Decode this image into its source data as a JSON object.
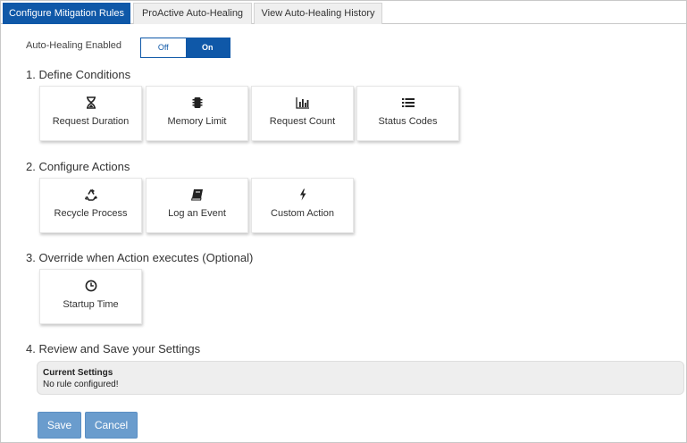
{
  "tabs": [
    {
      "label": "Configure Mitigation Rules",
      "active": true
    },
    {
      "label": "ProActive Auto-Healing",
      "active": false
    },
    {
      "label": "View Auto-Healing History",
      "active": false
    }
  ],
  "auto_healing": {
    "label": "Auto-Healing Enabled",
    "off_label": "Off",
    "on_label": "On",
    "selected": "On"
  },
  "sections": {
    "conditions": {
      "title": "1. Define Conditions",
      "cards": [
        {
          "label": "Request Duration",
          "icon": "hourglass-icon"
        },
        {
          "label": "Memory Limit",
          "icon": "memory-chip-icon"
        },
        {
          "label": "Request Count",
          "icon": "bar-chart-icon"
        },
        {
          "label": "Status Codes",
          "icon": "list-icon"
        }
      ]
    },
    "actions": {
      "title": "2. Configure Actions",
      "cards": [
        {
          "label": "Recycle Process",
          "icon": "recycle-icon"
        },
        {
          "label": "Log an Event",
          "icon": "book-icon"
        },
        {
          "label": "Custom Action",
          "icon": "bolt-icon"
        }
      ]
    },
    "override": {
      "title": "3. Override when Action executes (Optional)",
      "cards": [
        {
          "label": "Startup Time",
          "icon": "clock-icon"
        }
      ]
    },
    "review": {
      "title": "4. Review and Save your Settings",
      "current_settings_header": "Current Settings",
      "current_settings_value": "No rule configured!"
    }
  },
  "buttons": {
    "save": "Save",
    "cancel": "Cancel"
  },
  "colors": {
    "accent": "#0f58a8",
    "button": "#6a9ccd",
    "settings_bg": "#eeeeee"
  }
}
